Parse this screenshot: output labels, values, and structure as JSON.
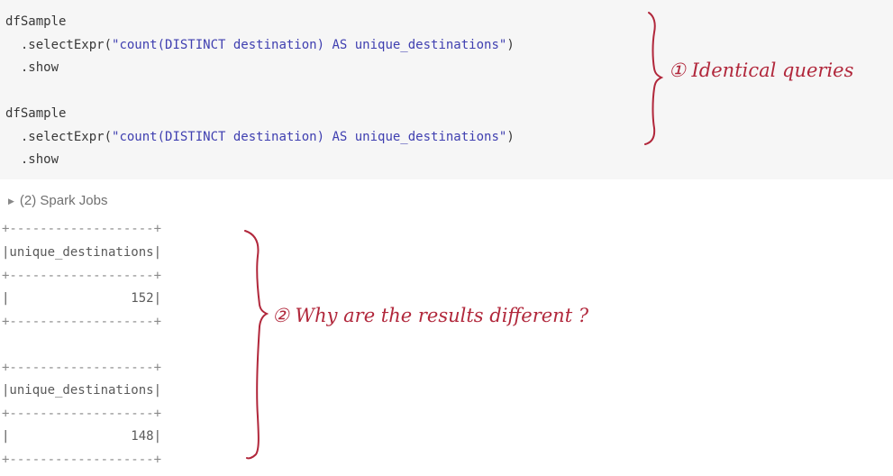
{
  "code_cell": {
    "block1": {
      "line1": "dfSample",
      "line2_prefix": "  .selectExpr(",
      "line2_string": "\"count(DISTINCT destination) AS unique_destinations\"",
      "line2_suffix": ")",
      "line3": "  .show"
    },
    "block2": {
      "line1": "dfSample",
      "line2_prefix": "  .selectExpr(",
      "line2_string": "\"count(DISTINCT destination) AS unique_destinations\"",
      "line2_suffix": ")",
      "line3": "  .show"
    }
  },
  "spark_jobs": {
    "toggle_icon": "triangle-right-icon",
    "label": "(2) Spark Jobs"
  },
  "output": {
    "table1": {
      "border": "+-------------------+",
      "header": "|unique_destinations|",
      "value_row": "|                152|"
    },
    "table2": {
      "border": "+-------------------+",
      "header": "|unique_destinations|",
      "value_row": "|                148|"
    }
  },
  "annotations": {
    "note1": "① Identical queries",
    "note2": "② Why are the results different ?",
    "color": "#b1273b"
  },
  "colors": {
    "code_background": "#f6f6f6",
    "string_literal": "#3f3fb0",
    "code_text": "#383838",
    "output_text": "#8a8a8a"
  }
}
